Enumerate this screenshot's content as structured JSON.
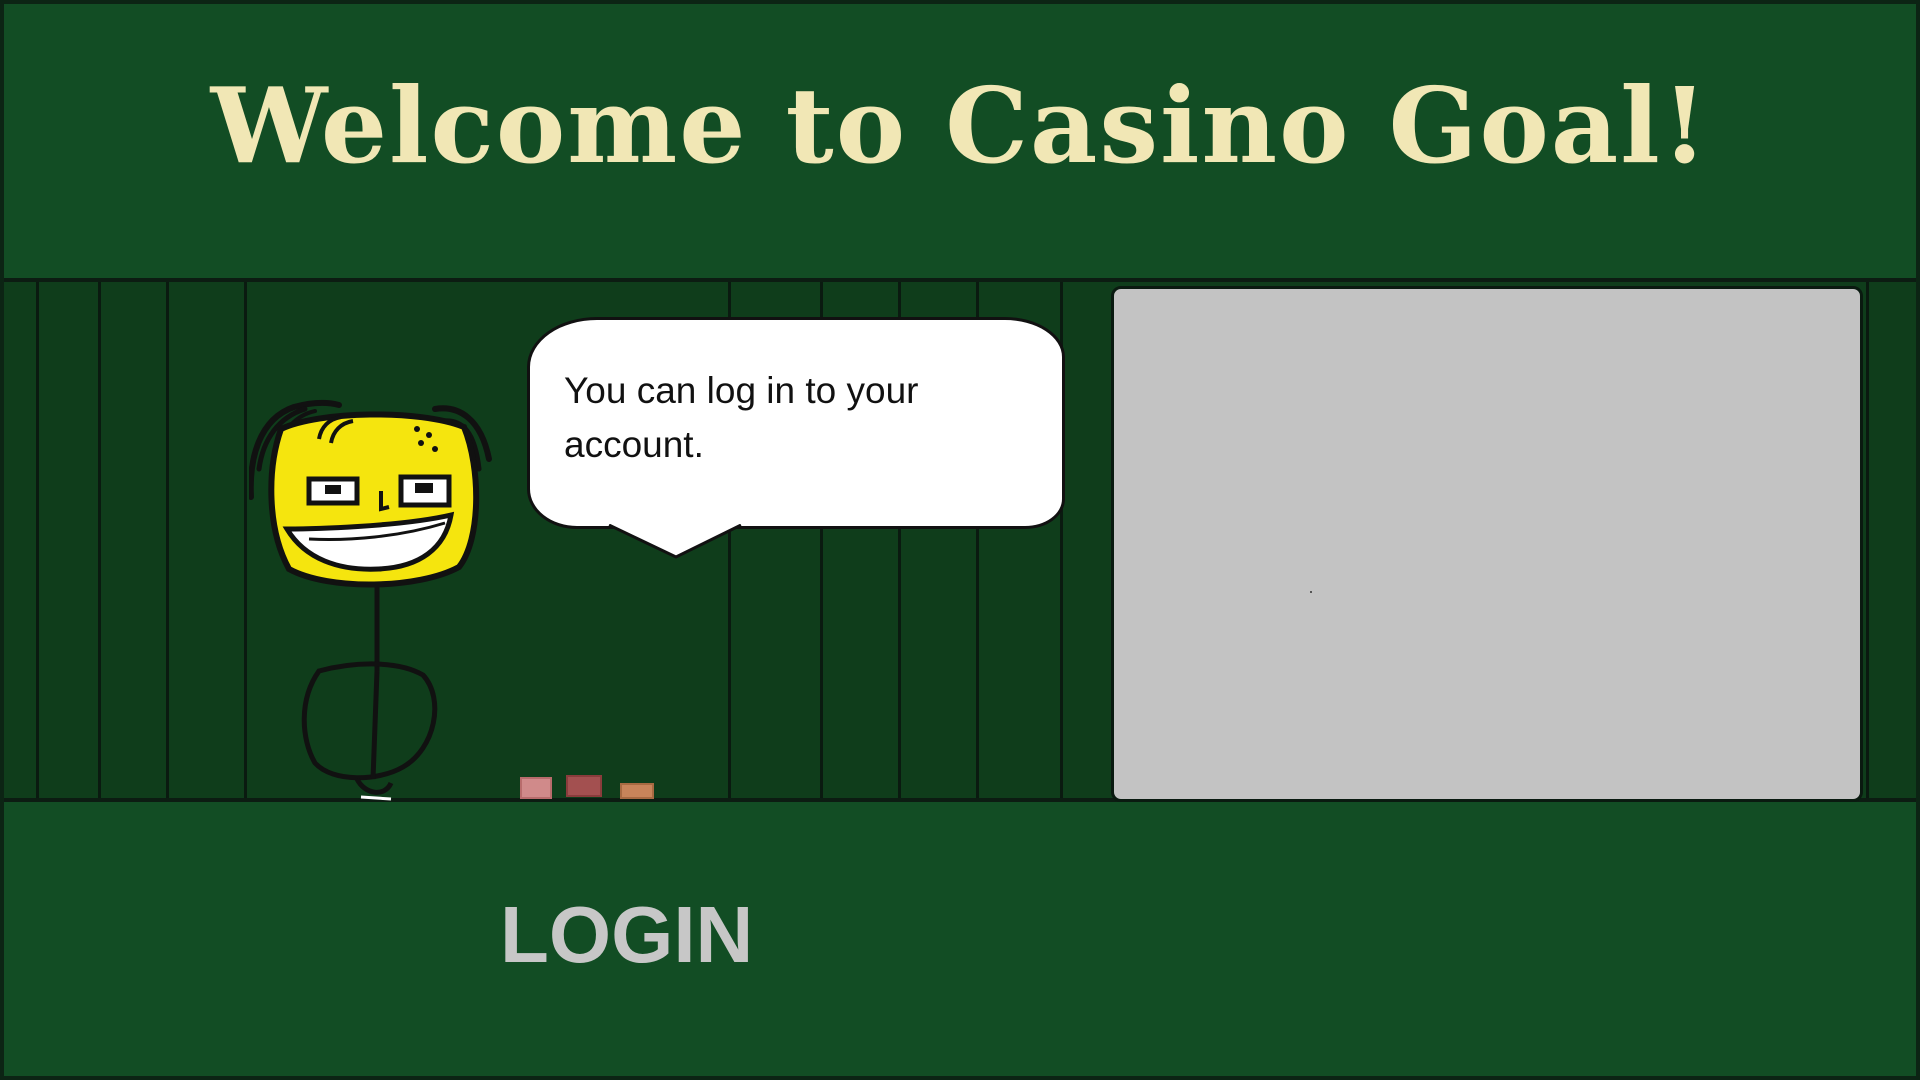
{
  "header": {
    "title": "Welcome to Casino Goal!"
  },
  "speech_bubble": {
    "text": "You can log in to your account."
  },
  "login": {
    "label": "LOGIN"
  },
  "colors": {
    "background": "#124d24",
    "wall": "#0f3d1b",
    "title": "#f1e7b5",
    "login_text": "#c7c7c7",
    "panel": "#c3c3c3",
    "character_face": "#f5e50e"
  },
  "icons": {
    "character": "cartoon-dealer-icon",
    "chips": "poker-chips-icon"
  }
}
